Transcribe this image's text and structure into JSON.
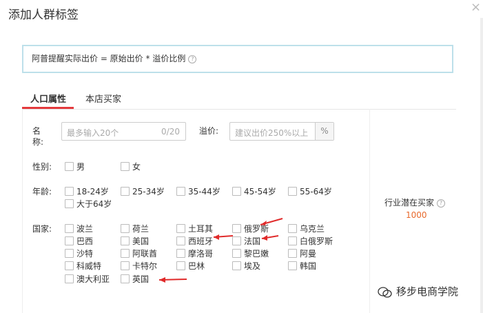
{
  "dialog": {
    "title": "添加人群标签",
    "close": "×"
  },
  "notice": {
    "text": "阿普提醒实际出价 = 原始出价 * 溢价比例",
    "help": "?"
  },
  "tabs": [
    {
      "label": "人口属性"
    },
    {
      "label": "本店买家"
    }
  ],
  "form": {
    "name_label_1": "名",
    "name_label_2": "称:",
    "name_placeholder": "最多输入20个",
    "name_count": "0/20",
    "premium_label": "溢价:",
    "premium_placeholder": "建议出价250%以上",
    "premium_unit": "%",
    "gender_label": "性别:",
    "gender": [
      "男",
      "女"
    ],
    "age_label": "年龄:",
    "age": [
      "18-24岁",
      "25-34岁",
      "35-44岁",
      "45-54岁",
      "55-64岁",
      "大于64岁"
    ],
    "country_label": "国家:",
    "countries": [
      "波兰",
      "荷兰",
      "土耳其",
      "俄罗斯",
      "乌克兰",
      "巴西",
      "美国",
      "西班牙",
      "法国",
      "白俄罗斯",
      "沙特",
      "阿联酋",
      "摩洛哥",
      "黎巴嫩",
      "阿曼",
      "科威特",
      "卡特尔",
      "巴林",
      "埃及",
      "韩国",
      "澳大利亚",
      "英国"
    ]
  },
  "side": {
    "label": "行业潜在买家",
    "help": "?",
    "value": "1000"
  },
  "watermark": {
    "text": "移步电商学院"
  },
  "colors": {
    "accent": "#e4393c",
    "notice_border": "#bde0ea",
    "value": "#e8682a"
  }
}
